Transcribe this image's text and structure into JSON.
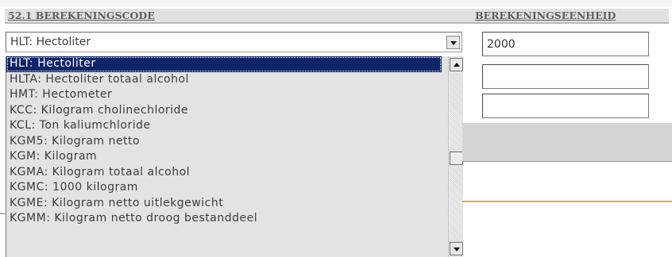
{
  "headers": {
    "code_label": "52.1 BEREKENINGSCODE",
    "unit_label": "BEREKENINGSEENHEID"
  },
  "select": {
    "value": "HLT: Hectoliter"
  },
  "dropdown": {
    "options": [
      "HLT: Hectoliter",
      "HLTA: Hectoliter totaal alcohol",
      "HMT: Hectometer",
      "KCC: Kilogram cholinechloride",
      "KCL: Ton kaliumchloride",
      "KGM5: Kilogram netto",
      "KGM: Kilogram",
      "KGMA: Kilogram totaal alcohol",
      "KGMC: 1000 kilogram",
      "KGME: Kilogram netto uitlekgewicht",
      "KGMM: Kilogram netto droog bestanddeel"
    ],
    "selected_index": 0
  },
  "unit_inputs": [
    "2000",
    "",
    ""
  ],
  "colors": {
    "selection": "#10246a",
    "accent_line": "#f2a23d",
    "header_text": "#5f5f5f"
  }
}
